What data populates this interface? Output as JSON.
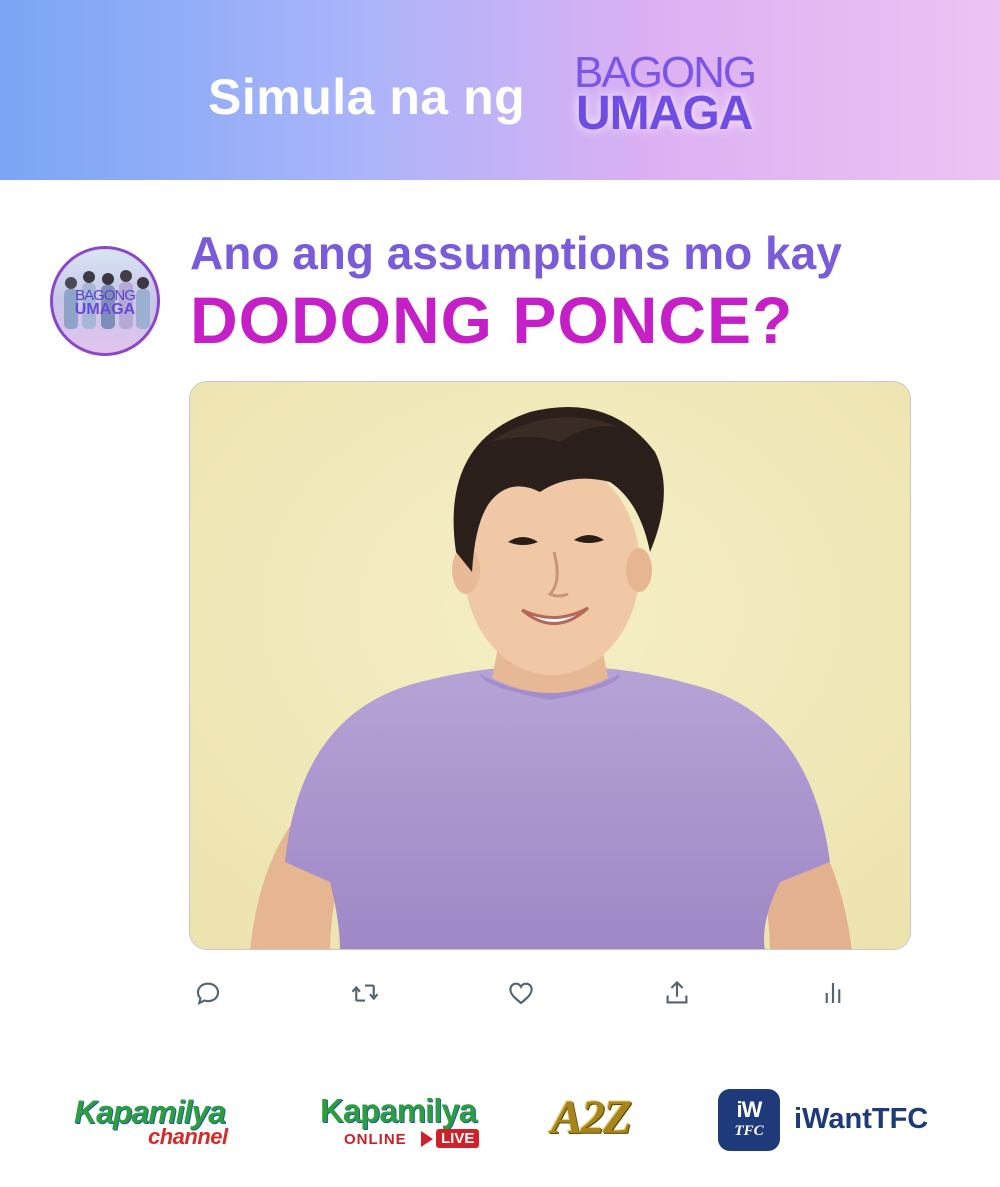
{
  "banner": {
    "tagline": "Simula na ng",
    "logo_top": "BAGONG",
    "logo_bottom": "UMAGA"
  },
  "account": {
    "avatar_top": "BAGONG",
    "avatar_bottom": "UMAGA"
  },
  "post": {
    "headline_line1": "Ano ang assumptions mo kay",
    "headline_line2": "DODONG PONCE?"
  },
  "actions": {
    "icons": [
      "reply-icon",
      "retweet-icon",
      "like-icon",
      "share-icon",
      "analytics-icon"
    ]
  },
  "footer": {
    "kapamilya_channel_top": "Kapamilya",
    "kapamilya_channel_bottom": "channel",
    "kapamilya_online_top": "Kapamilya",
    "kapamilya_online_bottom": "ONLINE",
    "kapamilya_online_live": "LIVE",
    "a2z": "A2Z",
    "iwant_icon_top": "iW",
    "iwant_icon_bottom": "TFC",
    "iwant_text": "iWantTFC"
  },
  "colors": {
    "headline_purple": "#7a5bd9",
    "headline_magenta": "#c51fc7",
    "icon_gray": "#536471"
  }
}
